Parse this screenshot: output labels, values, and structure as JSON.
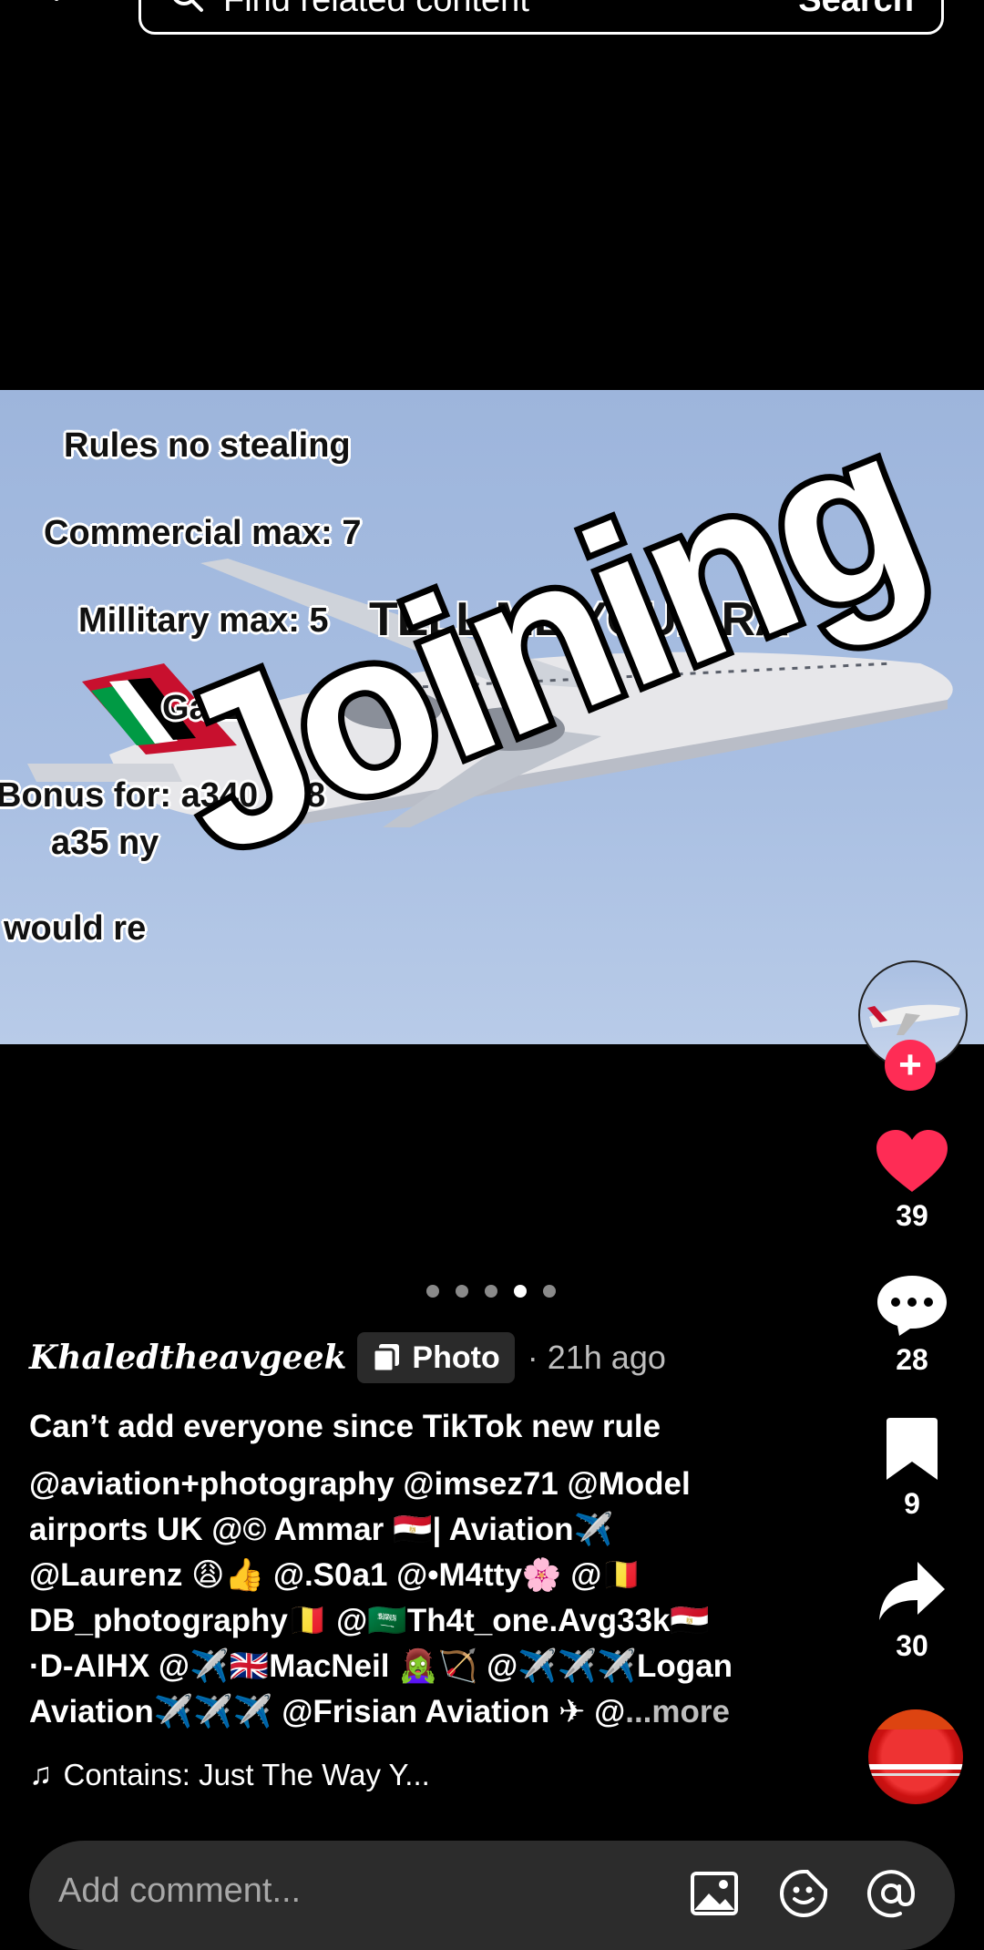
{
  "search": {
    "placeholder": "Find related content",
    "button": "Search"
  },
  "photo": {
    "overlay_lines": [
      "Rules no stealing",
      "Commercial max: 7",
      "Millitary max: 5",
      "Ga:2",
      "Bonus for: a340 a38",
      "a35        ny",
      "would re"
    ],
    "headline": "TELL ME YOUR     RA",
    "sticker": "Joining"
  },
  "actions": {
    "likes": "39",
    "comments": "28",
    "saves": "9",
    "shares": "30"
  },
  "carousel": {
    "count": 5,
    "active_index": 3
  },
  "post": {
    "author": "Khaledtheavgeek",
    "badge": "Photo",
    "time": "· 21h ago",
    "title": "Can’t add everyone since TikTok new rule",
    "caption_lines": [
      "@aviation+photography @imsez71 @Model",
      "airports UK @© Ammar 🇪🇬| Aviation✈️",
      "@Laurenz 😩👍 @.S0a1 @•M4tty🌸  @🇧🇪",
      "DB_photography🇧🇪 @🇸🇦Th4t_one.Avg33k🇪🇬",
      "·D-AIHX @✈️🇬🇧MacNeil 🧟‍♀️🏹 @✈️✈️✈️Logan",
      "Aviation✈️✈️✈️ @Frisian Aviation ✈ @"
    ],
    "more": "...more",
    "music": "Contains: Just The Way Y..."
  },
  "comment_bar": {
    "placeholder": "Add comment..."
  },
  "colors": {
    "accent": "#fe2c55",
    "background": "#000000",
    "sky": "#a9bfe2"
  }
}
